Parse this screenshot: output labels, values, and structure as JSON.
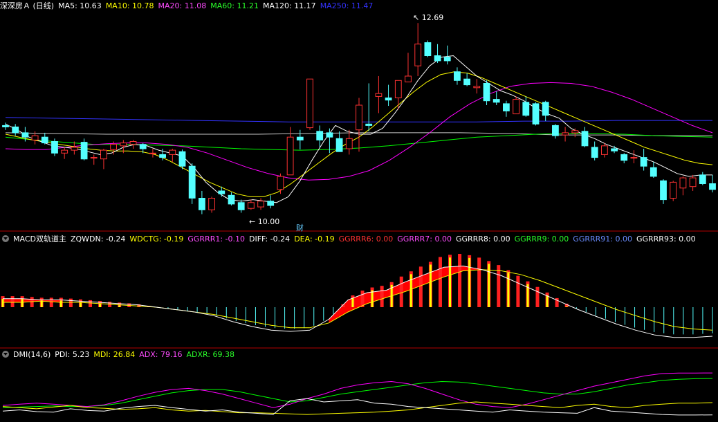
{
  "colors": {
    "up": "#ff3232",
    "down": "#54ffff",
    "ma5": "#ffffff",
    "ma10": "#ffff00",
    "ma20": "#ff00ff",
    "ma60": "#00ff00",
    "ma120": "#c8c8c8",
    "ma250": "#3333ff",
    "separator": "#b40000",
    "label_white": "#ffffff",
    "label_yellow": "#ffff00",
    "label_magenta": "#ff4cff",
    "label_green": "#2aff2a",
    "label_red": "#ff3232",
    "label_blue": "#6a8cff"
  },
  "main_panel": {
    "title": "深深房Ａ (日线)",
    "indicators": [
      {
        "label": "MA5: 10.63",
        "color": "#ffffff"
      },
      {
        "label": "MA10: 10.78",
        "color": "#ffff00"
      },
      {
        "label": "MA20: 11.08",
        "color": "#ff4cff"
      },
      {
        "label": "MA60: 11.21",
        "color": "#2aff2a"
      },
      {
        "label": "MA120: 11.17",
        "color": "#ffffff"
      },
      {
        "label": "MA250: 11.47",
        "color": "#3333ff"
      }
    ],
    "high_label": "12.69",
    "low_label": "10.00",
    "finance_mark": "财"
  },
  "macd_panel": {
    "title": "MACD双轨道主",
    "indicators": [
      {
        "label": "ZQWDN: -0.24",
        "color": "#ffffff"
      },
      {
        "label": "WDCTG: -0.19",
        "color": "#ffff00"
      },
      {
        "label": "GGRRR1: -0.10",
        "color": "#ff4cff"
      },
      {
        "label": "DIFF: -0.24",
        "color": "#ffffff"
      },
      {
        "label": "DEA: -0.19",
        "color": "#ffff00"
      },
      {
        "label": "GGRRR6: 0.00",
        "color": "#ff3232"
      },
      {
        "label": "GGRRR7: 0.00",
        "color": "#ff4cff"
      },
      {
        "label": "GGRRR8: 0.00",
        "color": "#ffffff"
      },
      {
        "label": "GGRRR9: 0.00",
        "color": "#2aff2a"
      },
      {
        "label": "GGRRR91: 0.00",
        "color": "#6a8cff"
      },
      {
        "label": "GGRRR93: 0.00",
        "color": "#ffffff"
      }
    ]
  },
  "dmi_panel": {
    "title": "DMI(14,6)",
    "indicators": [
      {
        "label": "PDI: 5.23",
        "color": "#ffffff"
      },
      {
        "label": "MDI: 26.84",
        "color": "#ffff00"
      },
      {
        "label": "ADX: 79.16",
        "color": "#ff4cff"
      },
      {
        "label": "ADXR: 69.38",
        "color": "#2aff2a"
      }
    ]
  },
  "chart_data": {
    "type": "candlestick",
    "price_range": [
      10.0,
      12.69
    ],
    "candles": [
      [
        11.28,
        11.32,
        11.22,
        11.26
      ],
      [
        11.26,
        11.3,
        11.14,
        11.18
      ],
      [
        11.18,
        11.26,
        11.06,
        11.12
      ],
      [
        11.08,
        11.2,
        11.02,
        11.14
      ],
      [
        11.12,
        11.18,
        11.02,
        11.04
      ],
      [
        11.06,
        11.1,
        10.86,
        10.9
      ],
      [
        10.9,
        10.98,
        10.82,
        10.94
      ],
      [
        10.94,
        11.06,
        10.88,
        10.98
      ],
      [
        11.05,
        11.1,
        10.8,
        10.82
      ],
      [
        10.84,
        10.88,
        10.74,
        10.84
      ],
      [
        10.82,
        10.96,
        10.68,
        10.94
      ],
      [
        10.95,
        11.06,
        10.88,
        11.02
      ],
      [
        11.0,
        11.08,
        10.9,
        11.04
      ],
      [
        11.02,
        11.08,
        10.96,
        11.06
      ],
      [
        11.02,
        11.04,
        10.9,
        10.96
      ],
      [
        10.9,
        10.96,
        10.84,
        10.9
      ],
      [
        10.88,
        10.96,
        10.8,
        10.84
      ],
      [
        10.88,
        10.96,
        10.78,
        10.94
      ],
      [
        10.92,
        10.95,
        10.68,
        10.72
      ],
      [
        10.72,
        10.76,
        10.2,
        10.28
      ],
      [
        10.28,
        10.38,
        10.06,
        10.12
      ],
      [
        10.12,
        10.3,
        10.08,
        10.28
      ],
      [
        10.38,
        10.44,
        10.3,
        10.34
      ],
      [
        10.32,
        10.36,
        10.18,
        10.2
      ],
      [
        10.22,
        10.26,
        10.08,
        10.12
      ],
      [
        10.14,
        10.26,
        10.12,
        10.22
      ],
      [
        10.16,
        10.28,
        10.12,
        10.24
      ],
      [
        10.24,
        10.32,
        10.14,
        10.18
      ],
      [
        10.4,
        10.62,
        10.34,
        10.58
      ],
      [
        10.6,
        11.26,
        10.8,
        11.12
      ],
      [
        11.12,
        11.22,
        10.95,
        11.08
      ],
      [
        11.25,
        11.92,
        11.22,
        11.92
      ],
      [
        11.2,
        11.28,
        10.98,
        11.08
      ],
      [
        11.18,
        11.24,
        10.9,
        11.12
      ],
      [
        11.1,
        11.2,
        10.94,
        10.92
      ],
      [
        10.96,
        11.22,
        10.88,
        11.1
      ],
      [
        11.22,
        11.66,
        10.92,
        11.56
      ],
      [
        11.3,
        11.86,
        11.2,
        11.28
      ],
      [
        11.68,
        11.96,
        11.45,
        11.72
      ],
      [
        11.66,
        11.84,
        11.55,
        11.63
      ],
      [
        11.66,
        11.9,
        11.5,
        11.9
      ],
      [
        11.88,
        12.28,
        11.92,
        11.96
      ],
      [
        12.1,
        12.69,
        11.96,
        12.4
      ],
      [
        12.42,
        12.45,
        12.22,
        12.24
      ],
      [
        12.24,
        12.4,
        12.14,
        12.17
      ],
      [
        12.22,
        12.38,
        12.12,
        12.17
      ],
      [
        12.02,
        12.08,
        11.84,
        11.9
      ],
      [
        11.92,
        12.0,
        11.82,
        11.84
      ],
      [
        11.8,
        11.92,
        11.72,
        11.82
      ],
      [
        11.86,
        11.9,
        11.56,
        11.62
      ],
      [
        11.64,
        11.75,
        11.56,
        11.6
      ],
      [
        11.58,
        11.62,
        11.4,
        11.48
      ],
      [
        11.44,
        11.68,
        11.44,
        11.64
      ],
      [
        11.6,
        11.68,
        11.4,
        11.42
      ],
      [
        11.58,
        11.6,
        11.28,
        11.3
      ],
      [
        11.6,
        11.62,
        11.34,
        11.42
      ],
      [
        11.28,
        11.3,
        11.1,
        11.14
      ],
      [
        11.15,
        11.26,
        11.06,
        11.18
      ],
      [
        11.18,
        11.24,
        11.12,
        11.21
      ],
      [
        11.2,
        11.26,
        10.98,
        11.0
      ],
      [
        10.98,
        11.06,
        10.8,
        10.84
      ],
      [
        10.88,
        11.04,
        10.84,
        11.0
      ],
      [
        10.96,
        11.0,
        10.9,
        10.93
      ],
      [
        10.88,
        10.9,
        10.76,
        10.8
      ],
      [
        10.84,
        10.94,
        10.76,
        10.84
      ],
      [
        10.84,
        10.96,
        10.66,
        10.72
      ],
      [
        10.7,
        10.78,
        10.56,
        10.58
      ],
      [
        10.52,
        10.54,
        10.2,
        10.26
      ],
      [
        10.28,
        10.52,
        10.24,
        10.5
      ],
      [
        10.42,
        10.58,
        10.32,
        10.56
      ],
      [
        10.44,
        10.6,
        10.38,
        10.56
      ],
      [
        10.6,
        10.64,
        10.46,
        10.48
      ],
      [
        10.48,
        10.6,
        10.36,
        10.4
      ]
    ],
    "ma": {
      "ma5": [
        [
          11.3,
          11.22,
          11.12,
          11.06,
          11.0,
          10.98,
          10.96,
          10.92,
          10.88,
          10.9,
          10.98,
          11.02,
          11.0,
          10.94,
          10.9,
          10.86,
          10.7,
          10.5,
          10.36,
          10.26,
          10.24,
          10.26,
          10.24,
          10.22,
          10.3,
          10.52,
          10.8,
          11.06,
          11.28,
          11.2,
          11.16,
          11.16,
          11.24,
          11.44,
          11.66,
          11.9,
          12.1,
          12.22,
          12.24,
          12.1,
          11.96,
          11.86,
          11.76,
          11.7,
          11.62,
          11.52,
          11.44,
          11.38,
          11.24,
          11.16,
          11.1,
          11.02,
          10.96,
          10.9,
          10.84,
          10.78,
          10.7,
          10.62,
          10.58,
          10.6,
          10.6
        ]
      ],
      "ma10": [
        [
          11.16,
          11.12,
          11.08,
          11.05,
          11.02,
          10.99,
          10.96,
          10.94,
          10.93,
          10.93,
          10.92,
          10.88,
          10.8,
          10.7,
          10.6,
          10.5,
          10.42,
          10.34,
          10.3,
          10.3,
          10.36,
          10.48,
          10.62,
          10.76,
          10.9,
          11.02,
          11.12,
          11.26,
          11.42,
          11.58,
          11.74,
          11.88,
          11.98,
          12.02,
          12.0,
          11.94,
          11.86,
          11.78,
          11.7,
          11.62,
          11.54,
          11.46,
          11.38,
          11.3,
          11.22,
          11.14,
          11.06,
          10.98,
          10.92,
          10.86,
          10.8,
          10.76,
          10.74
        ]
      ],
      "ma20": [
        [
          10.96,
          10.95,
          10.95,
          10.98,
          11.01,
          11.03,
          11.04,
          11.04,
          11.02,
          10.98,
          10.9,
          10.8,
          10.7,
          10.62,
          10.56,
          10.53,
          10.54,
          10.58,
          10.66,
          10.8,
          10.98,
          11.18,
          11.4,
          11.58,
          11.72,
          11.82,
          11.86,
          11.87,
          11.86,
          11.82,
          11.74,
          11.64,
          11.52,
          11.4,
          11.28,
          11.18
        ]
      ],
      "ma60": [
        [
          11.12,
          11.08,
          11.05,
          11.02,
          11.02,
          11.01,
          11.0,
          10.98,
          10.96,
          10.95,
          10.94,
          10.95,
          10.97,
          11.0,
          11.04,
          11.08,
          11.12,
          11.14,
          11.16,
          11.17,
          11.17,
          11.16,
          11.14,
          11.13,
          11.12
        ]
      ],
      "ma120": [
        [
          11.18,
          11.17,
          11.16,
          11.16,
          11.16,
          11.16,
          11.17,
          11.18,
          11.18,
          11.18,
          11.17,
          11.15,
          11.15,
          11.14,
          11.14
        ]
      ],
      "ma250": [
        [
          11.39,
          11.38,
          11.37,
          11.36,
          11.35,
          11.34,
          11.33,
          11.33,
          11.33,
          11.33,
          11.33,
          11.34,
          11.34,
          11.35,
          11.35,
          11.35
        ]
      ]
    },
    "macd": {
      "diff": [
        0.07,
        0.07,
        0.06,
        0.06,
        0.05,
        0.04,
        0.03,
        0.02,
        0.0,
        -0.02,
        -0.04,
        -0.07,
        -0.12,
        -0.16,
        -0.19,
        -0.2,
        -0.19,
        -0.1,
        0.06,
        0.12,
        0.14,
        0.21,
        0.27,
        0.33,
        0.34,
        0.31,
        0.26,
        0.19,
        0.12,
        0.05,
        -0.02,
        -0.08,
        -0.14,
        -0.19,
        -0.23,
        -0.25,
        -0.25,
        -0.24
      ],
      "dea": [
        0.04,
        0.04,
        0.05,
        0.04,
        0.04,
        0.03,
        0.02,
        0.01,
        0.0,
        -0.02,
        -0.04,
        -0.06,
        -0.09,
        -0.12,
        -0.15,
        -0.17,
        -0.17,
        -0.13,
        -0.04,
        0.03,
        0.08,
        0.13,
        0.19,
        0.25,
        0.3,
        0.31,
        0.3,
        0.27,
        0.22,
        0.16,
        0.1,
        0.04,
        -0.02,
        -0.07,
        -0.12,
        -0.16,
        -0.18,
        -0.19
      ]
    },
    "dmi": {
      "pdi": [
        12,
        14,
        11,
        10,
        16,
        13,
        12,
        17,
        20,
        22,
        18,
        15,
        12,
        14,
        10,
        8,
        6,
        30,
        34,
        28,
        30,
        32,
        26,
        24,
        20,
        18,
        16,
        14,
        12,
        10,
        14,
        12,
        10,
        9,
        8,
        18,
        12,
        10,
        8,
        6,
        5,
        5,
        5.23
      ],
      "mdi": [
        20,
        18,
        16,
        19,
        22,
        18,
        17,
        15,
        16,
        18,
        14,
        12,
        13,
        11,
        9,
        9,
        8,
        7,
        6,
        7,
        8,
        9,
        10,
        12,
        14,
        18,
        22,
        26,
        28,
        26,
        24,
        22,
        20,
        18,
        22,
        24,
        20,
        18,
        22,
        24,
        26,
        26,
        26.84
      ],
      "adx": [
        22,
        24,
        26,
        24,
        22,
        20,
        23,
        30,
        38,
        45,
        50,
        52,
        48,
        42,
        34,
        26,
        18,
        24,
        34,
        42,
        52,
        58,
        62,
        64,
        60,
        52,
        42,
        32,
        24,
        20,
        18,
        24,
        32,
        40,
        48,
        56,
        62,
        68,
        74,
        78,
        79,
        79,
        79.16
      ],
      "adxr": [
        18,
        19,
        20,
        21,
        20,
        20,
        22,
        26,
        32,
        38,
        44,
        48,
        50,
        50,
        46,
        40,
        34,
        28,
        30,
        36,
        42,
        46,
        50,
        54,
        58,
        62,
        64,
        63,
        60,
        56,
        52,
        48,
        44,
        42,
        42,
        46,
        52,
        58,
        62,
        66,
        68,
        69,
        69.38
      ]
    }
  }
}
